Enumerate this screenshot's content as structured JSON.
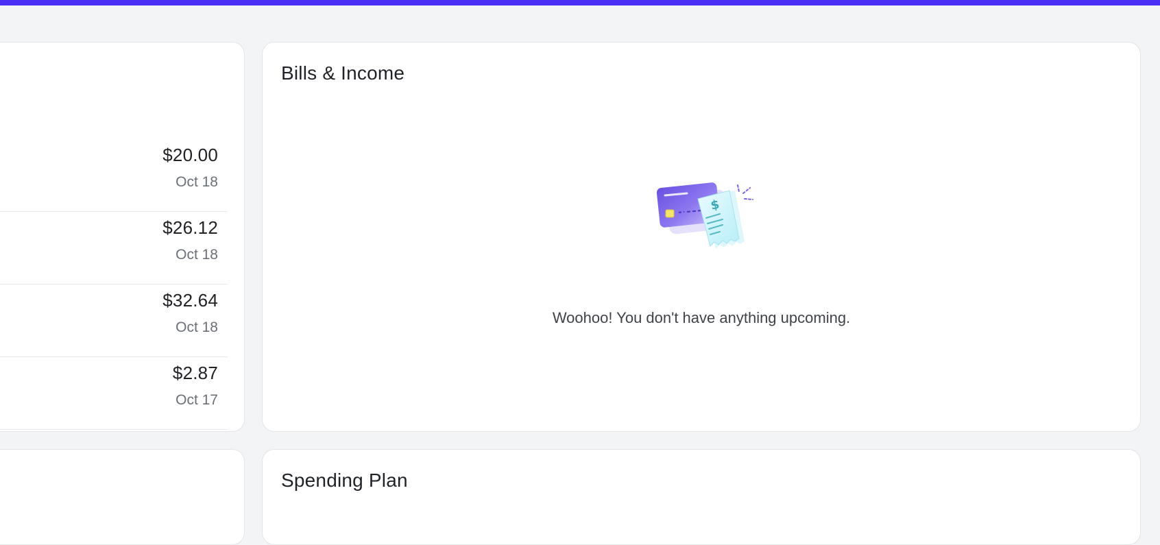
{
  "transactions": [
    {
      "amount": "$20.00",
      "date": "Oct 18"
    },
    {
      "amount": "$26.12",
      "date": "Oct 18"
    },
    {
      "amount": "$32.64",
      "date": "Oct 18"
    },
    {
      "amount": "$2.87",
      "date": "Oct 17"
    }
  ],
  "bills": {
    "title": "Bills & Income",
    "empty_message": "Woohoo! You don't have anything upcoming.",
    "illustration_icon": "credit-card-and-receipt-icon"
  },
  "spending": {
    "title": "Spending Plan"
  },
  "colors": {
    "accent": "#4a2ef5",
    "background": "#f3f4f6",
    "card": "#ffffff"
  }
}
